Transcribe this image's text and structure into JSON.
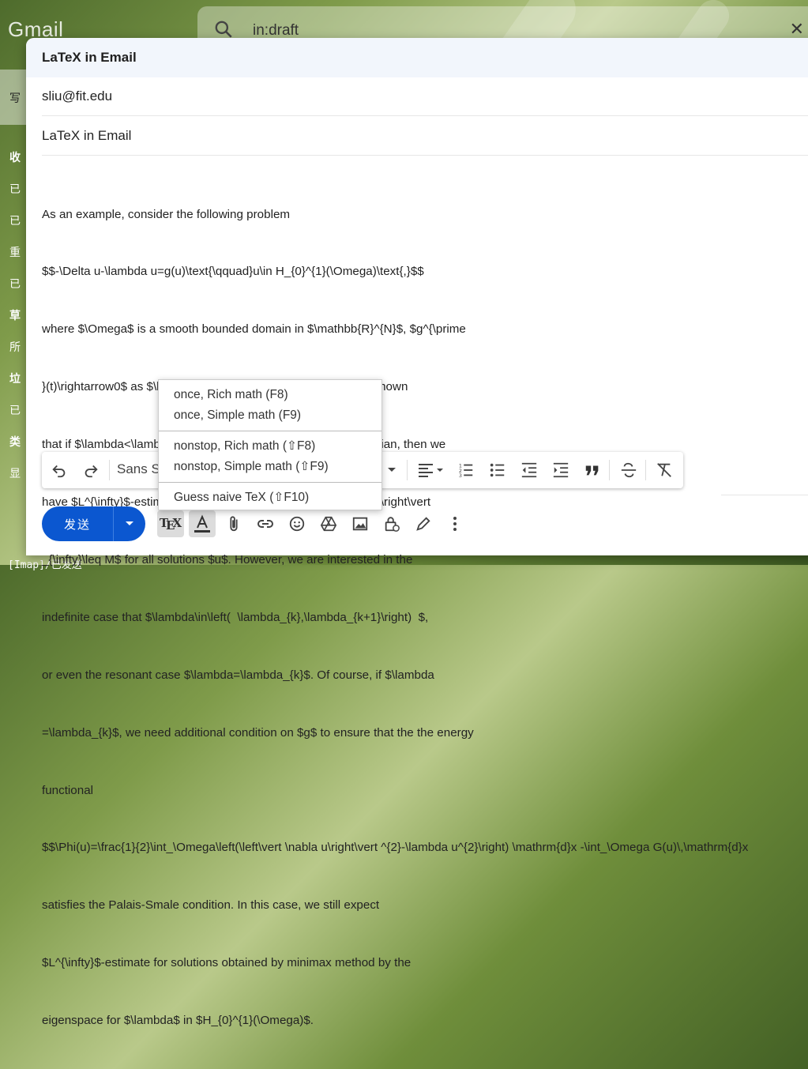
{
  "app": {
    "logo": "Gmail"
  },
  "search": {
    "query": "in:draft",
    "close": "✕"
  },
  "sidebar": {
    "compose_label": "写",
    "items": [
      {
        "label": "收",
        "top": 0
      },
      {
        "label": "已",
        "top": 0
      },
      {
        "label": "已",
        "top": 0
      },
      {
        "label": "重",
        "top": 0
      },
      {
        "label": "已",
        "top": 0
      },
      {
        "label": "草",
        "top": 0
      },
      {
        "label": "所",
        "top": 0
      },
      {
        "label": "垃",
        "top": 0
      },
      {
        "label": "已",
        "top": 0
      },
      {
        "label": "类",
        "top": 0
      },
      {
        "label": "显",
        "top": 0
      }
    ],
    "bottom_label": "[Imap]/已发送"
  },
  "compose": {
    "title": "LaTeX in Email",
    "to": "sliu@fit.edu",
    "subject": "LaTeX in Email",
    "body_lines": [
      "As an example, consider the following problem",
      "$$-\\Delta u-\\lambda u=g(u)\\text{\\qquad}u\\in H_{0}^{1}(\\Omega)\\text{,}$$",
      "where $\\Omega$ is a smooth bounded domain in $\\mathbb{R}^{N}$, $g^{\\prime",
      "}(t)\\rightarrow0$ as $\\left\\vert t\\right\\vert \\rightarrow\\infty$. It is known",
      "that if $\\lambda<\\lambda_{1}$, the first eigenvalue of the Laplacian, then we",
      "have $L^{\\infty}$-estimate: there is $M>0$ such that $\\left\\vert u\\right\\vert",
      "_{\\infty}\\leq M$ for all solutions $u$. However, we are interested in the",
      "indefinite case that $\\lambda\\in\\left(  \\lambda_{k},\\lambda_{k+1}\\right)  $,",
      "or even the resonant case $\\lambda=\\lambda_{k}$. Of course, if $\\lambda",
      "=\\lambda_{k}$, we need additional condition on $g$ to ensure that the the energy",
      "functional",
      "$$\\Phi(u)=\\frac{1}{2}\\int_\\Omega\\left(\\left\\vert \\nabla u\\right\\vert ^{2}-\\lambda u^{2}\\right) \\mathrm{d}x -\\int_\\Omega G(u)\\,\\mathrm{d}x",
      "satisfies the Palais-Smale condition. In this case, we still expect",
      "$L^{\\infty}$-estimate for solutions obtained by minimax method by the",
      "eigenspace for $\\lambda$ in $H_{0}^{1}(\\Omega)$."
    ]
  },
  "toolbar": {
    "font": "Sans Serif"
  },
  "send": {
    "label": "发送"
  },
  "tex_menu": {
    "groups": [
      [
        "once, Rich math (F8)",
        "once, Simple math (F9)"
      ],
      [
        "nonstop, Rich math (⇧F8)",
        "nonstop, Simple math (⇧F9)"
      ],
      [
        "Guess naive TeX (⇧F10)"
      ]
    ]
  },
  "colors": {
    "send_blue": "#0b57d0",
    "header_bg": "#f2f6fc"
  }
}
